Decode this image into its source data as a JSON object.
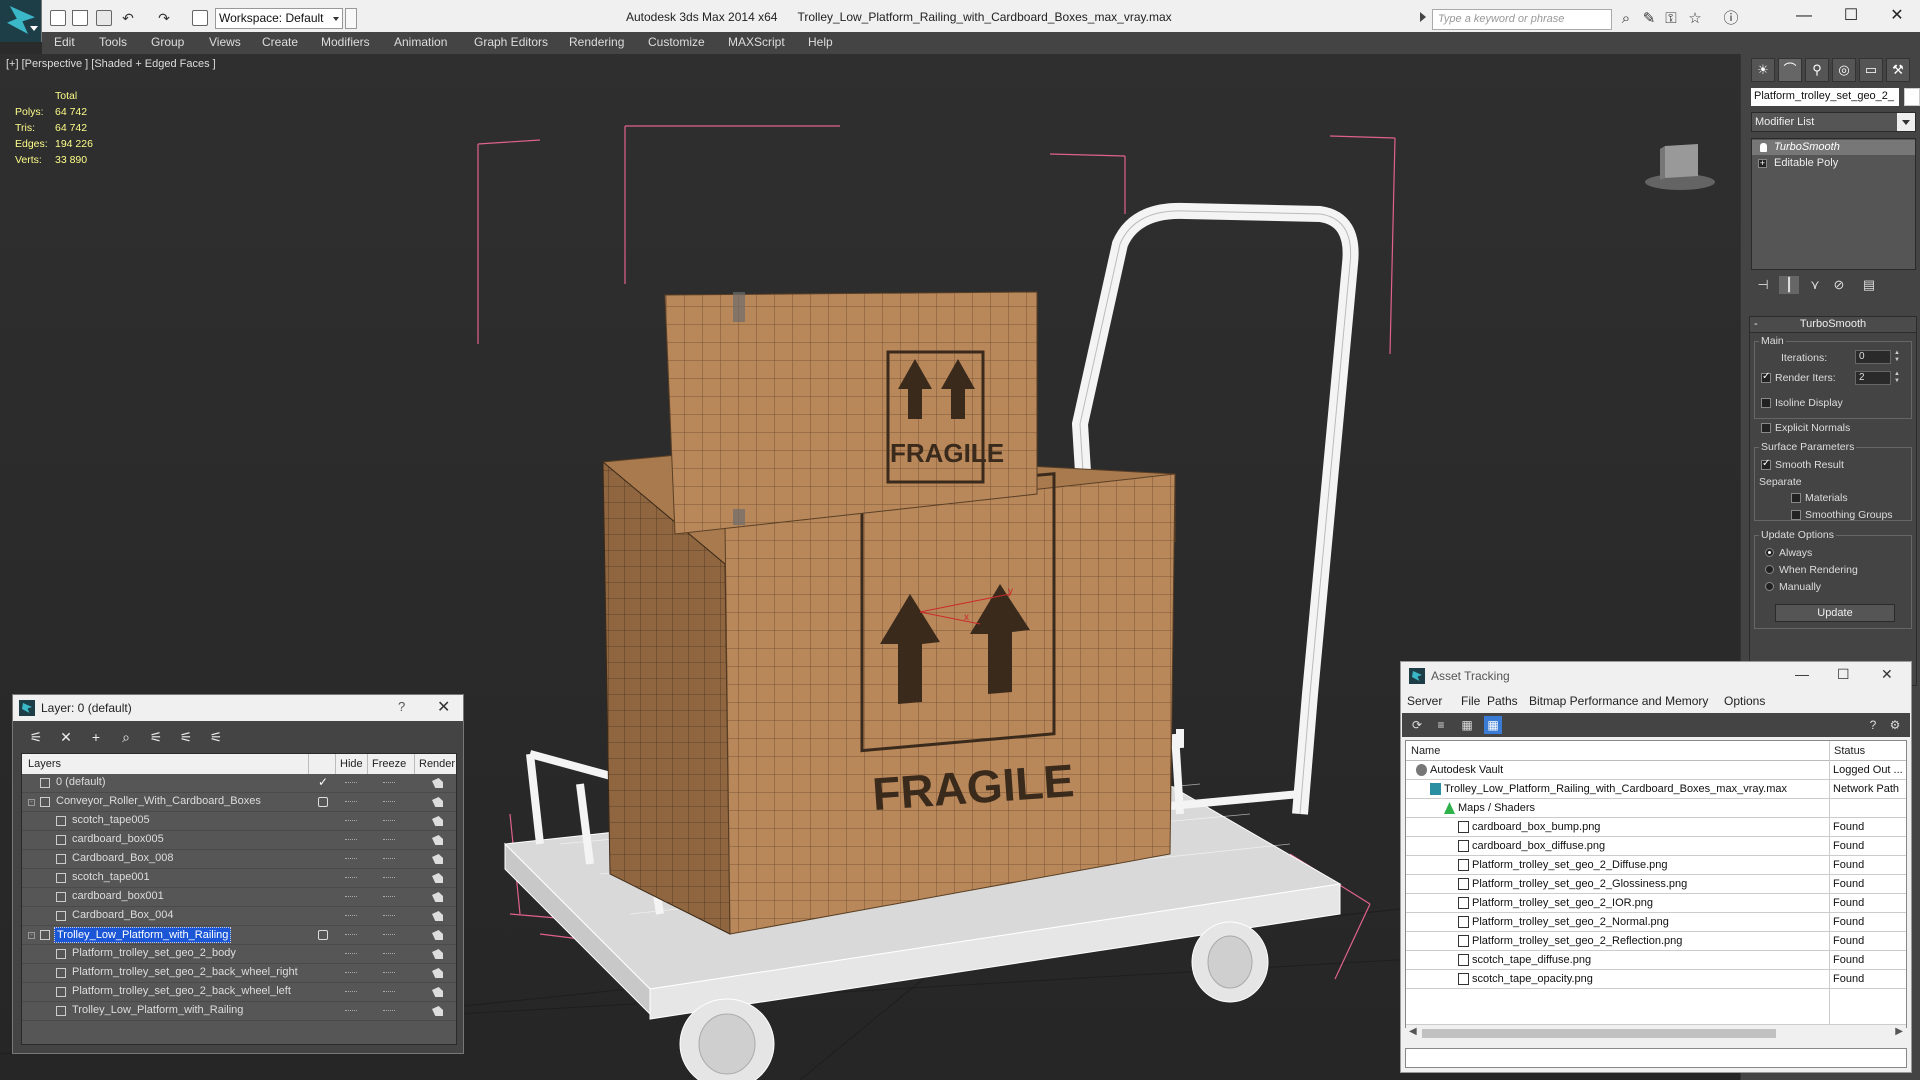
{
  "titlebar": {
    "workspace": "Workspace: Default",
    "app_name": "Autodesk 3ds Max  2014 x64",
    "file_name": "Trolley_Low_Platform_Railing_with_Cardboard_Boxes_max_vray.max",
    "search_placeholder": "Type a keyword or phrase"
  },
  "menu": [
    "Edit",
    "Tools",
    "Group",
    "Views",
    "Create",
    "Modifiers",
    "Animation",
    "Graph Editors",
    "Rendering",
    "Customize",
    "MAXScript",
    "Help"
  ],
  "viewport": {
    "label": "[+] [Perspective ] [Shaded + Edged Faces ]",
    "stats": {
      "header": "Total",
      "rows": [
        {
          "k": "Polys:",
          "v": "64 742"
        },
        {
          "k": "Tris:",
          "v": "64 742"
        },
        {
          "k": "Edges:",
          "v": "194 226"
        },
        {
          "k": "Verts:",
          "v": "33 890"
        }
      ]
    },
    "box_text": "FRAGILE",
    "axis_x": "x",
    "axis_y": "y"
  },
  "command_panel": {
    "object_name": "Platform_trolley_set_geo_2_",
    "modifier_list": "Modifier List",
    "stack": [
      "TurboSmooth",
      "Editable Poly"
    ],
    "rollout": {
      "title": "TurboSmooth",
      "main": "Main",
      "iterations_label": "Iterations:",
      "iterations": "0",
      "render_iters_label": "Render Iters:",
      "render_iters": "2",
      "isoline": "Isoline Display",
      "explicit_normals": "Explicit Normals",
      "surface_params": "Surface Parameters",
      "smooth_result": "Smooth Result",
      "separate": "Separate",
      "materials": "Materials",
      "smoothing_groups": "Smoothing Groups",
      "update_options": "Update Options",
      "always": "Always",
      "when_rendering": "When Rendering",
      "manually": "Manually",
      "update_btn": "Update"
    }
  },
  "layer_dialog": {
    "title": "Layer: 0 (default)",
    "help": "?",
    "columns": {
      "layers": "Layers",
      "hide": "Hide",
      "freeze": "Freeze",
      "render": "Render"
    },
    "rows": [
      {
        "name": "0 (default)",
        "level": 0,
        "type": "layer",
        "current": true
      },
      {
        "name": "Conveyor_Roller_With_Cardboard_Boxes",
        "level": 0,
        "type": "layer"
      },
      {
        "name": "scotch_tape005",
        "level": 1,
        "type": "obj"
      },
      {
        "name": "cardboard_box005",
        "level": 1,
        "type": "obj"
      },
      {
        "name": "Cardboard_Box_008",
        "level": 1,
        "type": "obj"
      },
      {
        "name": "scotch_tape001",
        "level": 1,
        "type": "obj"
      },
      {
        "name": "cardboard_box001",
        "level": 1,
        "type": "obj"
      },
      {
        "name": "Cardboard_Box_004",
        "level": 1,
        "type": "obj"
      },
      {
        "name": "Trolley_Low_Platform_with_Railing",
        "level": 0,
        "type": "layer",
        "selected": true
      },
      {
        "name": "Platform_trolley_set_geo_2_body",
        "level": 1,
        "type": "obj"
      },
      {
        "name": "Platform_trolley_set_geo_2_back_wheel_right",
        "level": 1,
        "type": "obj"
      },
      {
        "name": "Platform_trolley_set_geo_2_back_wheel_left",
        "level": 1,
        "type": "obj"
      },
      {
        "name": "Trolley_Low_Platform_with_Railing",
        "level": 1,
        "type": "obj"
      }
    ]
  },
  "asset_dialog": {
    "title": "Asset Tracking",
    "menu": [
      "Server",
      "File",
      "Paths",
      "Bitmap Performance and Memory",
      "Options"
    ],
    "columns": {
      "name": "Name",
      "status": "Status"
    },
    "rows": [
      {
        "name": "Autodesk Vault",
        "status": "Logged Out ...",
        "level": 0,
        "icon": "vault"
      },
      {
        "name": "Trolley_Low_Platform_Railing_with_Cardboard_Boxes_max_vray.max",
        "status": "Network Path",
        "level": 1,
        "icon": "max"
      },
      {
        "name": "Maps / Shaders",
        "status": "",
        "level": 2,
        "icon": "maps"
      },
      {
        "name": "cardboard_box_bump.png",
        "status": "Found",
        "level": 3,
        "icon": "file"
      },
      {
        "name": "cardboard_box_diffuse.png",
        "status": "Found",
        "level": 3,
        "icon": "file"
      },
      {
        "name": "Platform_trolley_set_geo_2_Diffuse.png",
        "status": "Found",
        "level": 3,
        "icon": "file"
      },
      {
        "name": "Platform_trolley_set_geo_2_Glossiness.png",
        "status": "Found",
        "level": 3,
        "icon": "file"
      },
      {
        "name": "Platform_trolley_set_geo_2_IOR.png",
        "status": "Found",
        "level": 3,
        "icon": "file"
      },
      {
        "name": "Platform_trolley_set_geo_2_Normal.png",
        "status": "Found",
        "level": 3,
        "icon": "file"
      },
      {
        "name": "Platform_trolley_set_geo_2_Reflection.png",
        "status": "Found",
        "level": 3,
        "icon": "file"
      },
      {
        "name": "scotch_tape_diffuse.png",
        "status": "Found",
        "level": 3,
        "icon": "file"
      },
      {
        "name": "scotch_tape_opacity.png",
        "status": "Found",
        "level": 3,
        "icon": "file"
      }
    ]
  },
  "colors": {
    "selection": "#1a56d6",
    "stats_text": "#fdfd8a",
    "cardboard": "#b8875a",
    "bbox_pink": "#e0628c"
  }
}
